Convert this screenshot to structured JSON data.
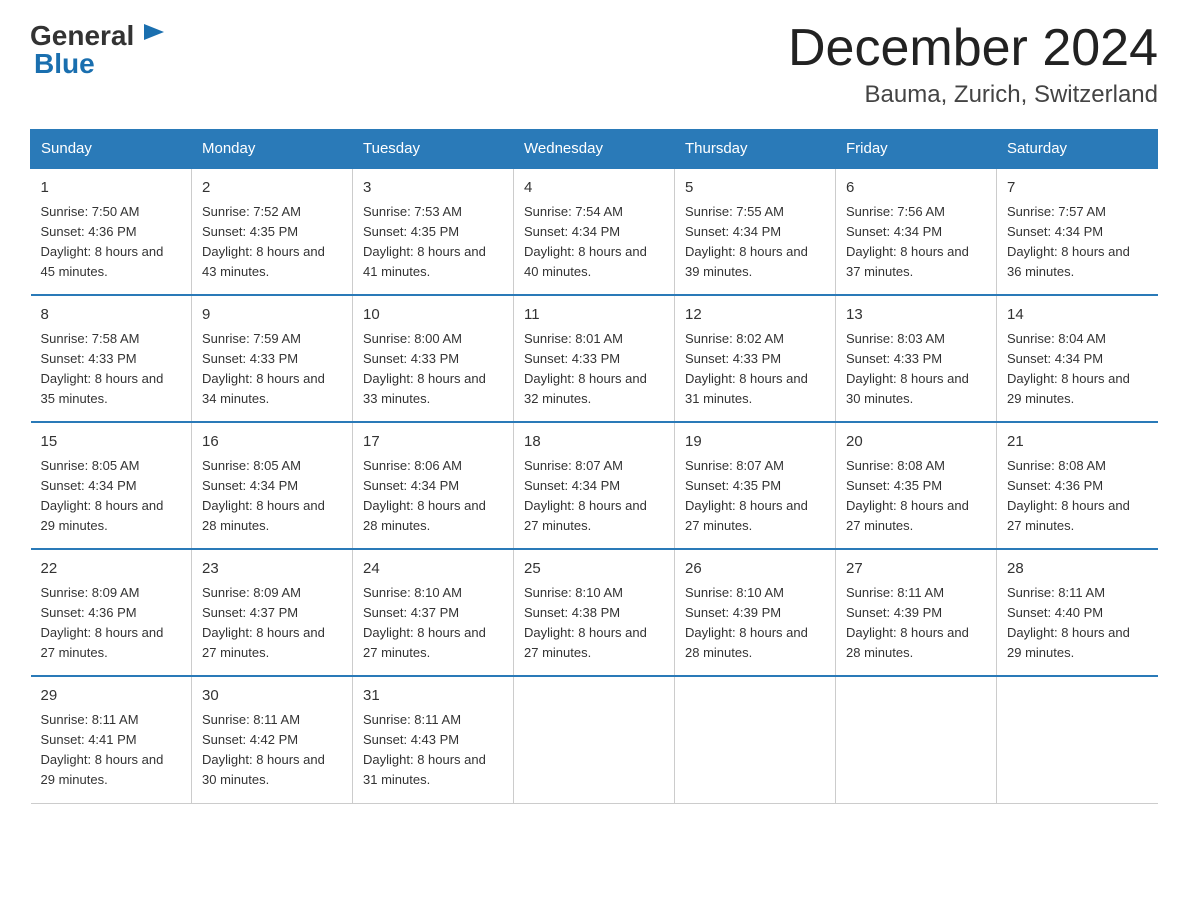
{
  "header": {
    "logo_general": "General",
    "logo_blue": "Blue",
    "month_title": "December 2024",
    "location": "Bauma, Zurich, Switzerland"
  },
  "days_of_week": [
    "Sunday",
    "Monday",
    "Tuesday",
    "Wednesday",
    "Thursday",
    "Friday",
    "Saturday"
  ],
  "weeks": [
    [
      {
        "day": "1",
        "sunrise": "7:50 AM",
        "sunset": "4:36 PM",
        "daylight": "8 hours and 45 minutes."
      },
      {
        "day": "2",
        "sunrise": "7:52 AM",
        "sunset": "4:35 PM",
        "daylight": "8 hours and 43 minutes."
      },
      {
        "day": "3",
        "sunrise": "7:53 AM",
        "sunset": "4:35 PM",
        "daylight": "8 hours and 41 minutes."
      },
      {
        "day": "4",
        "sunrise": "7:54 AM",
        "sunset": "4:34 PM",
        "daylight": "8 hours and 40 minutes."
      },
      {
        "day": "5",
        "sunrise": "7:55 AM",
        "sunset": "4:34 PM",
        "daylight": "8 hours and 39 minutes."
      },
      {
        "day": "6",
        "sunrise": "7:56 AM",
        "sunset": "4:34 PM",
        "daylight": "8 hours and 37 minutes."
      },
      {
        "day": "7",
        "sunrise": "7:57 AM",
        "sunset": "4:34 PM",
        "daylight": "8 hours and 36 minutes."
      }
    ],
    [
      {
        "day": "8",
        "sunrise": "7:58 AM",
        "sunset": "4:33 PM",
        "daylight": "8 hours and 35 minutes."
      },
      {
        "day": "9",
        "sunrise": "7:59 AM",
        "sunset": "4:33 PM",
        "daylight": "8 hours and 34 minutes."
      },
      {
        "day": "10",
        "sunrise": "8:00 AM",
        "sunset": "4:33 PM",
        "daylight": "8 hours and 33 minutes."
      },
      {
        "day": "11",
        "sunrise": "8:01 AM",
        "sunset": "4:33 PM",
        "daylight": "8 hours and 32 minutes."
      },
      {
        "day": "12",
        "sunrise": "8:02 AM",
        "sunset": "4:33 PM",
        "daylight": "8 hours and 31 minutes."
      },
      {
        "day": "13",
        "sunrise": "8:03 AM",
        "sunset": "4:33 PM",
        "daylight": "8 hours and 30 minutes."
      },
      {
        "day": "14",
        "sunrise": "8:04 AM",
        "sunset": "4:34 PM",
        "daylight": "8 hours and 29 minutes."
      }
    ],
    [
      {
        "day": "15",
        "sunrise": "8:05 AM",
        "sunset": "4:34 PM",
        "daylight": "8 hours and 29 minutes."
      },
      {
        "day": "16",
        "sunrise": "8:05 AM",
        "sunset": "4:34 PM",
        "daylight": "8 hours and 28 minutes."
      },
      {
        "day": "17",
        "sunrise": "8:06 AM",
        "sunset": "4:34 PM",
        "daylight": "8 hours and 28 minutes."
      },
      {
        "day": "18",
        "sunrise": "8:07 AM",
        "sunset": "4:34 PM",
        "daylight": "8 hours and 27 minutes."
      },
      {
        "day": "19",
        "sunrise": "8:07 AM",
        "sunset": "4:35 PM",
        "daylight": "8 hours and 27 minutes."
      },
      {
        "day": "20",
        "sunrise": "8:08 AM",
        "sunset": "4:35 PM",
        "daylight": "8 hours and 27 minutes."
      },
      {
        "day": "21",
        "sunrise": "8:08 AM",
        "sunset": "4:36 PM",
        "daylight": "8 hours and 27 minutes."
      }
    ],
    [
      {
        "day": "22",
        "sunrise": "8:09 AM",
        "sunset": "4:36 PM",
        "daylight": "8 hours and 27 minutes."
      },
      {
        "day": "23",
        "sunrise": "8:09 AM",
        "sunset": "4:37 PM",
        "daylight": "8 hours and 27 minutes."
      },
      {
        "day": "24",
        "sunrise": "8:10 AM",
        "sunset": "4:37 PM",
        "daylight": "8 hours and 27 minutes."
      },
      {
        "day": "25",
        "sunrise": "8:10 AM",
        "sunset": "4:38 PM",
        "daylight": "8 hours and 27 minutes."
      },
      {
        "day": "26",
        "sunrise": "8:10 AM",
        "sunset": "4:39 PM",
        "daylight": "8 hours and 28 minutes."
      },
      {
        "day": "27",
        "sunrise": "8:11 AM",
        "sunset": "4:39 PM",
        "daylight": "8 hours and 28 minutes."
      },
      {
        "day": "28",
        "sunrise": "8:11 AM",
        "sunset": "4:40 PM",
        "daylight": "8 hours and 29 minutes."
      }
    ],
    [
      {
        "day": "29",
        "sunrise": "8:11 AM",
        "sunset": "4:41 PM",
        "daylight": "8 hours and 29 minutes."
      },
      {
        "day": "30",
        "sunrise": "8:11 AM",
        "sunset": "4:42 PM",
        "daylight": "8 hours and 30 minutes."
      },
      {
        "day": "31",
        "sunrise": "8:11 AM",
        "sunset": "4:43 PM",
        "daylight": "8 hours and 31 minutes."
      },
      null,
      null,
      null,
      null
    ]
  ],
  "labels": {
    "sunrise": "Sunrise:",
    "sunset": "Sunset:",
    "daylight": "Daylight:"
  }
}
